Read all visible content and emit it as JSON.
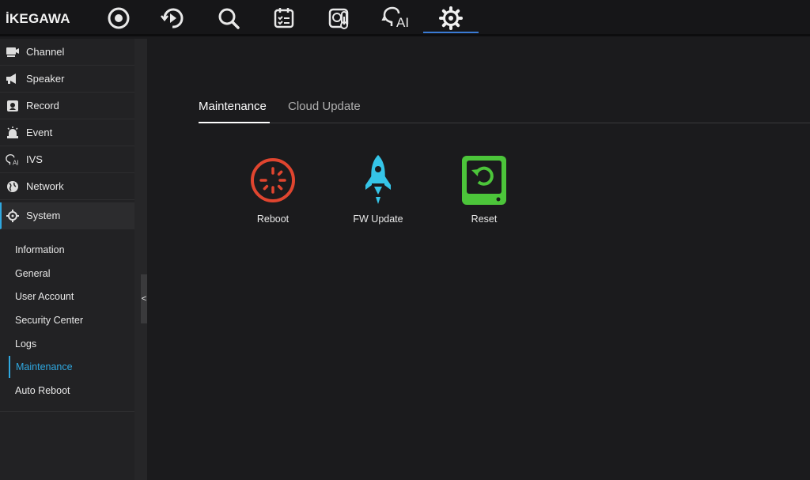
{
  "brand": {
    "logo_text": "İKEGAWA"
  },
  "topnav": {
    "icons": [
      "live-view-icon",
      "playback-icon",
      "search-icon",
      "calendar-schedule-icon",
      "thermal-icon",
      "ai-icon",
      "settings-gear-icon"
    ],
    "active": "settings-gear-icon",
    "ai_text": "AI",
    "accent": "#3a7bd5"
  },
  "sidebar": {
    "items": [
      {
        "label": "Channel",
        "icon": "camera-icon"
      },
      {
        "label": "Speaker",
        "icon": "megaphone-icon"
      },
      {
        "label": "Record",
        "icon": "record-icon"
      },
      {
        "label": "Event",
        "icon": "alarm-icon"
      },
      {
        "label": "IVS",
        "icon": "ai-head-icon"
      },
      {
        "label": "Network",
        "icon": "globe-icon"
      },
      {
        "label": "System",
        "icon": "gear-icon"
      }
    ],
    "active": "System",
    "sub_items": [
      {
        "label": "Information"
      },
      {
        "label": "General"
      },
      {
        "label": "User Account"
      },
      {
        "label": "Security Center"
      },
      {
        "label": "Logs"
      },
      {
        "label": "Maintenance"
      },
      {
        "label": "Auto Reboot"
      }
    ],
    "active_sub": "Maintenance",
    "collapse_glyph": "<",
    "accent": "#2fa8e0"
  },
  "main": {
    "tabs": [
      {
        "label": "Maintenance"
      },
      {
        "label": "Cloud Update"
      }
    ],
    "active_tab": "Maintenance",
    "actions": [
      {
        "label": "Reboot",
        "icon": "reboot-icon",
        "color": "#e0452f"
      },
      {
        "label": "FW Update",
        "icon": "rocket-icon",
        "color": "#35c5e8"
      },
      {
        "label": "Reset",
        "icon": "reset-icon",
        "color": "#4cc53a"
      }
    ]
  }
}
